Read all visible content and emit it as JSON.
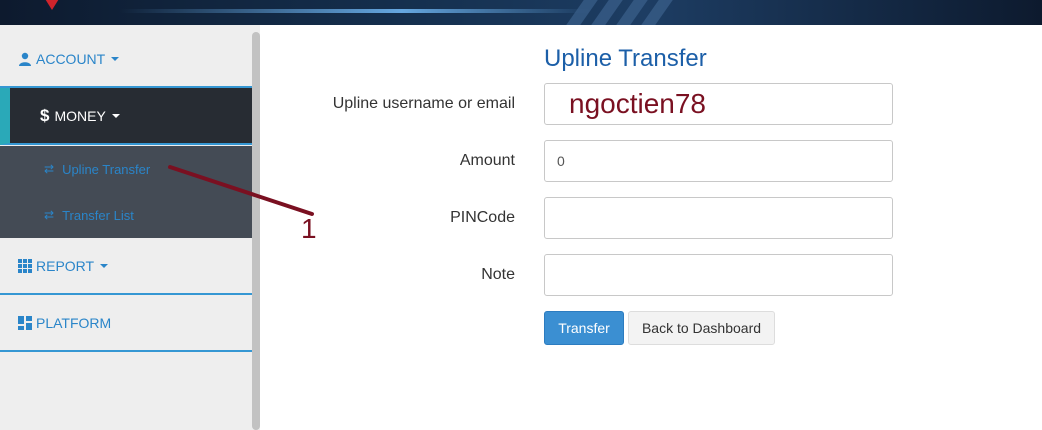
{
  "sidebar": {
    "items": [
      {
        "label": "ACCOUNT",
        "icon": "user-icon"
      },
      {
        "label": "MONEY",
        "icon": "dollar-icon"
      },
      {
        "label": "REPORT",
        "icon": "grid-icon"
      },
      {
        "label": "PLATFORM",
        "icon": "dashboard-icon"
      }
    ],
    "money_symbol": "$",
    "submenu": [
      {
        "label": "Upline Transfer",
        "icon": "transfer-icon"
      },
      {
        "label": "Transfer List",
        "icon": "transfer-icon"
      }
    ]
  },
  "form": {
    "title": "Upline Transfer",
    "fields": [
      {
        "label": "Upline username or email",
        "value": "ngoctien78"
      },
      {
        "label": "Amount",
        "value": "0"
      },
      {
        "label": "PINCode",
        "value": ""
      },
      {
        "label": "Note",
        "value": ""
      }
    ],
    "submit_label": "Transfer",
    "back_label": "Back to Dashboard"
  },
  "annotation": {
    "number": "1"
  },
  "colors": {
    "accent": "#2a85c9",
    "primary_button": "#3b8fd2",
    "active_bg": "#272c33",
    "submenu_bg": "#444b55",
    "annotation": "#7a1021",
    "title": "#1c5fa8"
  }
}
